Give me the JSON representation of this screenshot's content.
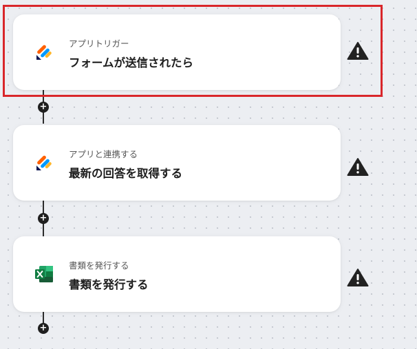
{
  "flow": {
    "steps": [
      {
        "subtitle": "アプリトリガー",
        "title": "フォームが送信されたら",
        "icon": "jotform-icon",
        "status_icon": "warning-icon"
      },
      {
        "subtitle": "アプリと連携する",
        "title": "最新の回答を取得する",
        "icon": "jotform-icon",
        "status_icon": "warning-icon"
      },
      {
        "subtitle": "書類を発行する",
        "title": "書類を発行する",
        "icon": "excel-icon",
        "status_icon": "warning-icon"
      }
    ],
    "add_step_glyph": "+"
  },
  "colors": {
    "highlight": "#d9262a",
    "jotform_blue": "#0a1551",
    "jotform_orange": "#ff6100",
    "jotform_yellow": "#ffb629",
    "jotform_light_blue": "#0099ff",
    "excel_green": "#107c41",
    "warning_icon": "#222222"
  }
}
